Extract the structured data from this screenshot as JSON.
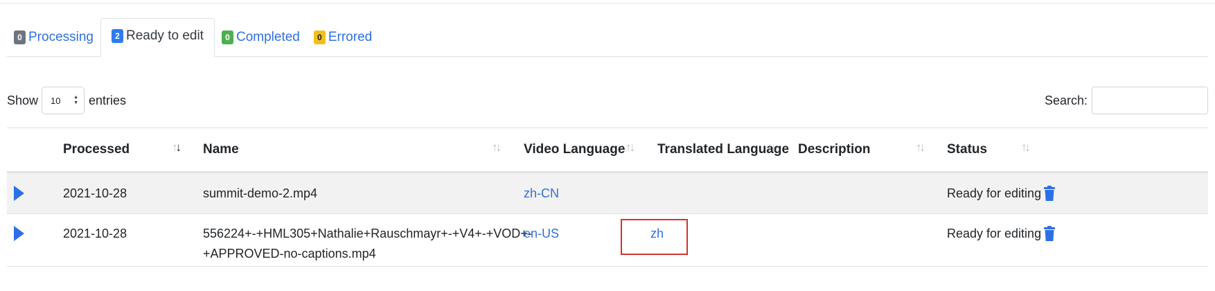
{
  "tabs": [
    {
      "count": "0",
      "label": "Processing"
    },
    {
      "count": "2",
      "label": "Ready to edit"
    },
    {
      "count": "0",
      "label": "Completed"
    },
    {
      "count": "0",
      "label": "Errored"
    }
  ],
  "controls": {
    "show_label": "Show",
    "page_length": "10",
    "entries_label": "entries",
    "search_label": "Search:",
    "search_value": ""
  },
  "table": {
    "columns": [
      "Processed",
      "Name",
      "Video Language",
      "Translated Language",
      "Description",
      "Status"
    ],
    "rows": [
      {
        "processed": "2021-10-28",
        "name_line1": "summit-demo-2.mp4",
        "name_line2": "",
        "video_language": "zh-CN",
        "translated_language": "",
        "description": "",
        "status": "Ready for editing"
      },
      {
        "processed": "2021-10-28",
        "name_line1": "556224+-+HML305+Nathalie+Rauschmayr+-+V4+-+VOD+-",
        "name_line2": "+APPROVED-no-captions.mp4",
        "video_language": "en-US",
        "translated_language": "zh",
        "description": "",
        "status": "Ready for editing"
      }
    ]
  },
  "colors": {
    "accent": "#2f6fe0",
    "highlight": "#d0342c",
    "badge_ready": "#2d7bf0",
    "badge_completed": "#4caf50",
    "badge_errored": "#f2c01b"
  },
  "icons": {
    "row_action": "play-icon",
    "delete": "trash-icon"
  }
}
